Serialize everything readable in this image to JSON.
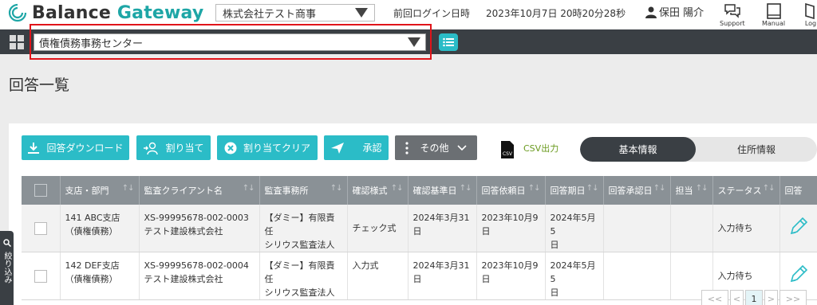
{
  "header": {
    "brand_part1": "Balance ",
    "brand_part2": "Gateway",
    "company": "株式会社テスト商事",
    "last_login_label": "前回ログイン日時",
    "last_login_value": "2023年10月7日 20時20分28秒",
    "user_name": "保田 陽介",
    "support_label": "Support",
    "manual_label": "Manual",
    "logout_label": "Log"
  },
  "office_select": {
    "value": "債権債務事務センター"
  },
  "page": {
    "title": "回答一覧"
  },
  "toolbar": {
    "download": "回答ダウンロード",
    "assign": "割り当て",
    "assign_clear": "割り当てクリア",
    "approve": "承認",
    "other": "その他",
    "csv_icon": "CSV",
    "csv_export": "CSV出力"
  },
  "tabs": {
    "basic": "基本情報",
    "address": "住所情報"
  },
  "table": {
    "headers": {
      "branch": "支店・部門",
      "client": "監査クライアント名",
      "firm": "監査事務所",
      "form": "確認様式",
      "base_date": "確認基準日",
      "request_date": "回答依頼日",
      "due_date": "回答期日",
      "approved_date": "回答承認日",
      "owner": "担当",
      "status": "ステータス",
      "answer": "回答"
    },
    "rows": [
      {
        "branch1": "141 ABC支店",
        "branch2": "（債権債務）",
        "client1": "XS-99995678-002-0003",
        "client2": "テスト建設株式会社",
        "firm1": "【ダミー】有限責任",
        "firm2": "シリウス監査法人",
        "form": "チェック式",
        "base1": "2024年3月31",
        "base2": "日",
        "req1": "2023年10月9",
        "req2": "日",
        "due1": "2024年5月5",
        "due2": "日",
        "approved": "",
        "owner": "",
        "status": "入力待ち"
      },
      {
        "branch1": "142 DEF支店",
        "branch2": "（債権債務）",
        "client1": "XS-99995678-002-0004",
        "client2": "テスト建設株式会社",
        "firm1": "【ダミー】有限責任",
        "firm2": "シリウス監査法人",
        "form": "入力式",
        "base1": "2024年3月31",
        "base2": "日",
        "req1": "2023年10月9",
        "req2": "日",
        "due1": "2024年5月5",
        "due2": "日",
        "approved": "",
        "owner": "",
        "status": "入力待ち"
      }
    ]
  },
  "pager": {
    "first": "<<",
    "prev": "<",
    "current": "1",
    "next": ">",
    "last": ">>"
  },
  "side_tab": {
    "text": "絞り込み"
  },
  "colors": {
    "accent": "#2bbcc7",
    "dark": "#3a3f44",
    "highlight": "#e0141a"
  }
}
